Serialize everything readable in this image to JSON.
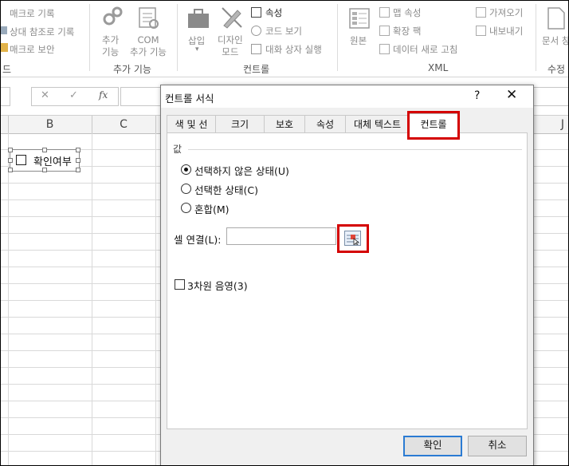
{
  "ribbon": {
    "code_group": {
      "items": [
        "매크로 기록",
        "상대 참조로 기록",
        "매크로 보안"
      ],
      "group_label": "드"
    },
    "addins_group": {
      "items": [
        "추가\n기능",
        "COM\n추가 기능"
      ],
      "label_lines": [
        [
          "추가",
          "기능"
        ],
        [
          "COM",
          "추가 기능"
        ]
      ],
      "group_label": "추가 기능"
    },
    "controls_group": {
      "insert_label": "삽입",
      "design_mode_label": [
        "디자인",
        "모드"
      ],
      "small_items": [
        "속성",
        "코드 보기",
        "대화 상자 실행"
      ],
      "group_label": "컨트롤"
    },
    "xml_group": {
      "source_label": "원본",
      "items_col1": [
        "맵 속성",
        "확장 팩",
        "데이터 새로 고침"
      ],
      "items_col2": [
        "가져오기",
        "내보내기"
      ],
      "group_label": "XML"
    },
    "modify_group": {
      "doc_label": "문서 창",
      "group_label": "수정"
    }
  },
  "formula_bar": {
    "cancel_symbol": "✕",
    "enter_symbol": "✓",
    "fx_symbol": "fx",
    "value": ""
  },
  "sheet": {
    "columns": [
      "B",
      "C",
      "J"
    ],
    "checkbox_label": "확인여부"
  },
  "dialog": {
    "title": "컨트롤 서식",
    "help_symbol": "?",
    "close_symbol": "✕",
    "tabs": [
      "색 및 선",
      "크기",
      "보호",
      "속성",
      "대체 텍스트",
      "컨트롤"
    ],
    "active_tab": "컨트롤",
    "value_section_label": "값",
    "radios": [
      {
        "label": "선택하지 않은 상태(U)",
        "selected": true
      },
      {
        "label": "선택한 상태(C)",
        "selected": false
      },
      {
        "label": "혼합(M)",
        "selected": false
      }
    ],
    "cell_link_label": "셀 연결(L):",
    "cell_link_value": "",
    "shading_3d_label": "3차원 음영(3)",
    "shading_3d_checked": false,
    "ok_label": "확인",
    "cancel_label": "취소",
    "highlight_color": "#d40000"
  }
}
